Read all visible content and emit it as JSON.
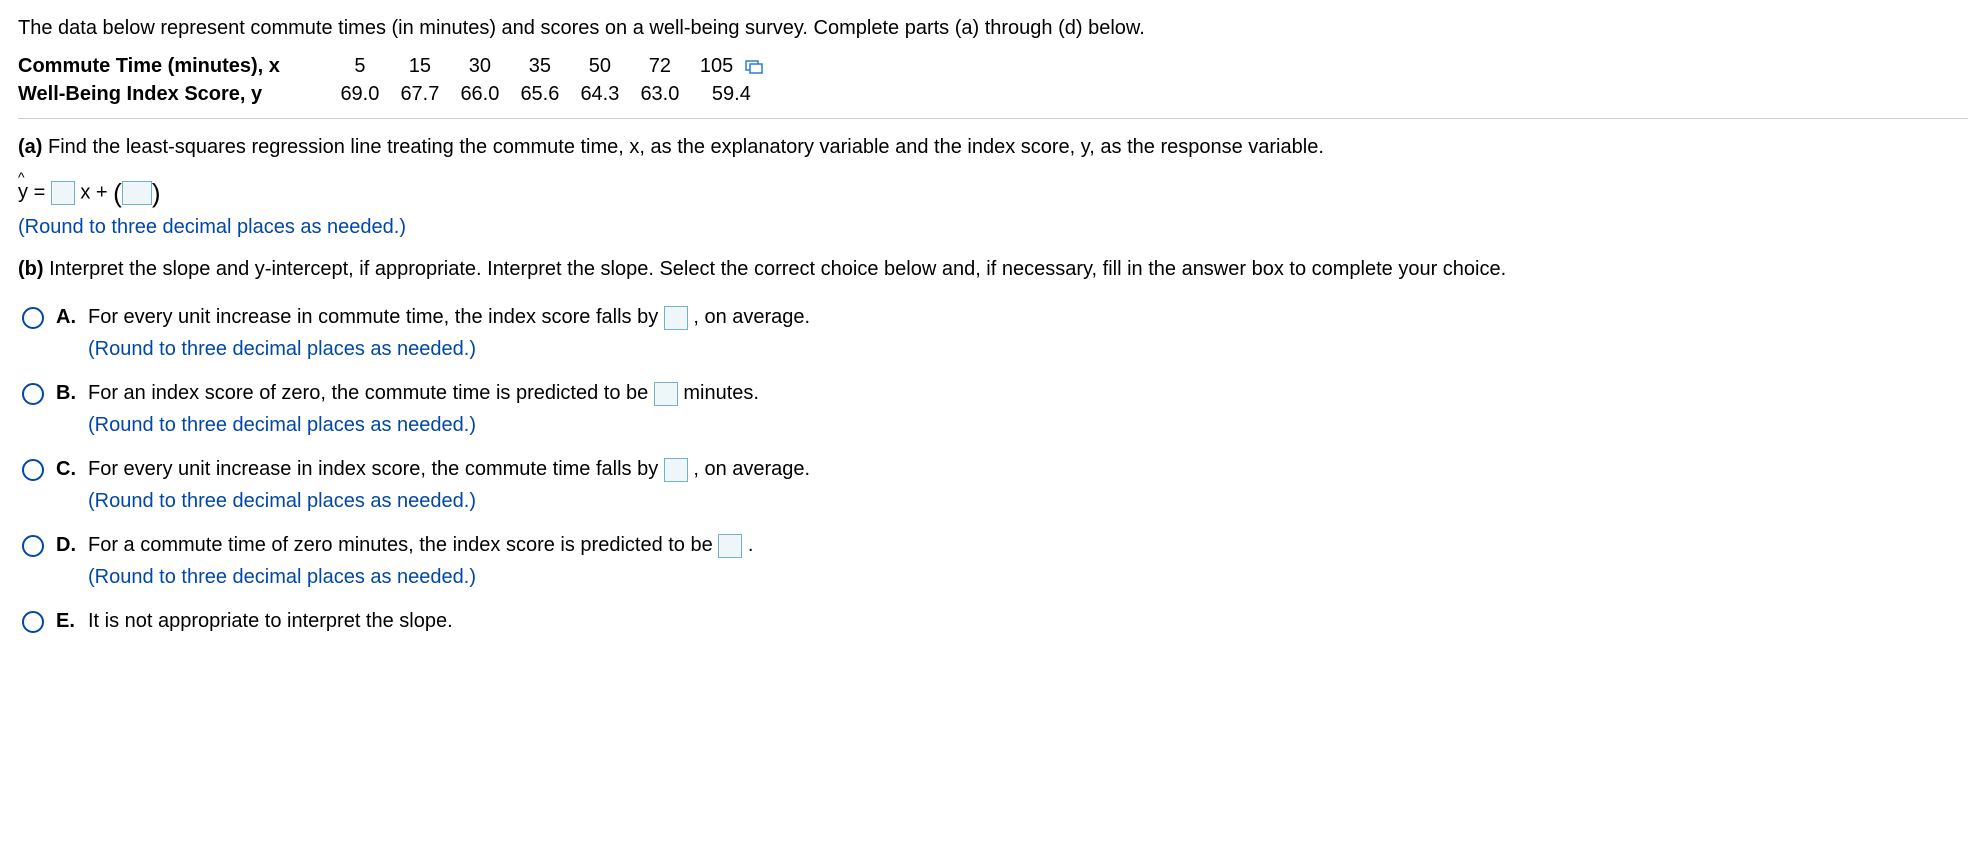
{
  "intro": "The data below represent commute times (in minutes) and scores on a well-being survey. Complete parts (a) through (d) below.",
  "table": {
    "row1_label": "Commute Time (minutes), x",
    "row2_label": "Well-Being Index Score, y",
    "x": [
      "5",
      "15",
      "30",
      "35",
      "50",
      "72",
      "105"
    ],
    "y": [
      "69.0",
      "67.7",
      "66.0",
      "65.6",
      "64.3",
      "63.0",
      "59.4"
    ]
  },
  "part_a": {
    "letter": "(a)",
    "text": " Find the least-squares regression line treating the commute time, x, as the explanatory variable and the index score, y, as the response variable.",
    "eq_pre": "y = ",
    "eq_mid": "x + ",
    "hint": "(Round to three decimal places as needed.)"
  },
  "part_b": {
    "letter": "(b)",
    "text": " Interpret the slope and y-intercept, if appropriate. Interpret the slope. Select the correct choice below and, if necessary, fill in the answer box to complete your choice."
  },
  "choices": {
    "A": {
      "letter": "A.",
      "t1": "For every unit increase in commute time, the index score falls by ",
      "t2": ", on average.",
      "hint": "(Round to three decimal places as needed.)"
    },
    "B": {
      "letter": "B.",
      "t1": "For an index score of zero, the commute time is predicted to be ",
      "t2": " minutes.",
      "hint": "(Round to three decimal places as needed.)"
    },
    "C": {
      "letter": "C.",
      "t1": "For every unit increase in index score, the commute time falls by ",
      "t2": ", on average.",
      "hint": "(Round to three decimal places as needed.)"
    },
    "D": {
      "letter": "D.",
      "t1": "For a commute time of zero minutes, the index score is predicted to be ",
      "t2": ".",
      "hint": "(Round to three decimal places as needed.)"
    },
    "E": {
      "letter": "E.",
      "t1": "It is not appropriate to interpret the slope."
    }
  }
}
